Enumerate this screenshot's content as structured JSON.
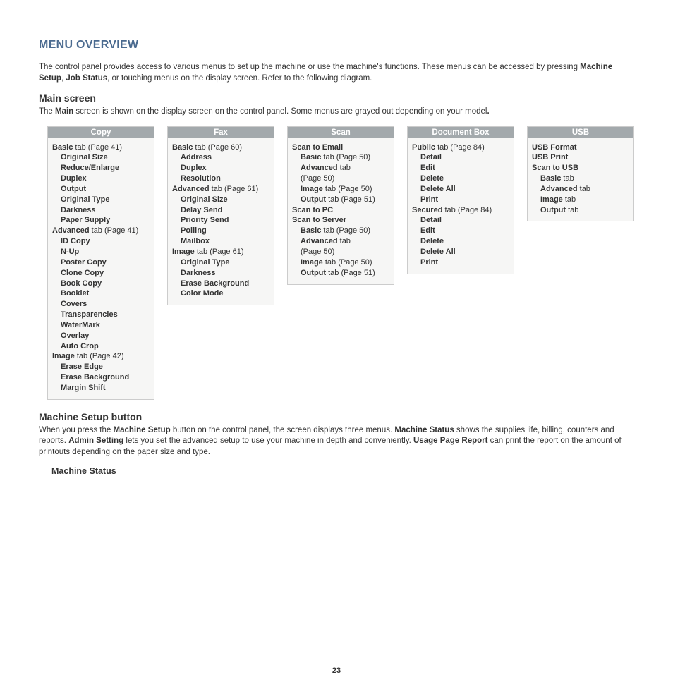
{
  "title": "MENU OVERVIEW",
  "intro_pre": "The control panel provides access to various menus to set up the machine or use the machine's functions. These menus can be accessed by pressing ",
  "intro_b1": "Machine Setup",
  "intro_mid1": ", ",
  "intro_b2": "Job Status",
  "intro_post": ", or touching menus on the display screen. Refer to the following diagram.",
  "main_screen_heading": "Main screen",
  "main_desc_pre": "The ",
  "main_desc_b": "Main",
  "main_desc_post": " screen is shown on the display screen on the control panel. Some menus are grayed out depending on your model",
  "main_desc_dot": ".",
  "columns": {
    "copy": {
      "header": "Copy",
      "items": [
        {
          "lvl": 0,
          "b": "Basic",
          "rest": " tab (Page 41)"
        },
        {
          "lvl": 1,
          "b": "Original Size",
          "rest": ""
        },
        {
          "lvl": 1,
          "b": "Reduce/Enlarge",
          "rest": ""
        },
        {
          "lvl": 1,
          "b": "Duplex",
          "rest": ""
        },
        {
          "lvl": 1,
          "b": "Output",
          "rest": ""
        },
        {
          "lvl": 1,
          "b": "Original Type",
          "rest": ""
        },
        {
          "lvl": 1,
          "b": "Darkness",
          "rest": ""
        },
        {
          "lvl": 1,
          "b": "Paper Supply",
          "rest": ""
        },
        {
          "lvl": 0,
          "b": "Advanced",
          "rest": " tab (Page 41)"
        },
        {
          "lvl": 1,
          "b": "ID Copy",
          "rest": ""
        },
        {
          "lvl": 1,
          "b": "N-Up",
          "rest": ""
        },
        {
          "lvl": 1,
          "b": "Poster Copy",
          "rest": ""
        },
        {
          "lvl": 1,
          "b": "Clone Copy",
          "rest": ""
        },
        {
          "lvl": 1,
          "b": "Book Copy",
          "rest": ""
        },
        {
          "lvl": 1,
          "b": "Booklet",
          "rest": ""
        },
        {
          "lvl": 1,
          "b": "Covers",
          "rest": ""
        },
        {
          "lvl": 1,
          "b": "Transparencies",
          "rest": ""
        },
        {
          "lvl": 1,
          "b": "WaterMark",
          "rest": ""
        },
        {
          "lvl": 1,
          "b": "Overlay",
          "rest": ""
        },
        {
          "lvl": 1,
          "b": "Auto Crop",
          "rest": ""
        },
        {
          "lvl": 0,
          "b": "Image",
          "rest": " tab (Page 42)"
        },
        {
          "lvl": 1,
          "b": "Erase Edge",
          "rest": ""
        },
        {
          "lvl": 1,
          "b": "Erase Background",
          "rest": ""
        },
        {
          "lvl": 1,
          "b": "Margin Shift",
          "rest": ""
        }
      ]
    },
    "fax": {
      "header": "Fax",
      "items": [
        {
          "lvl": 0,
          "b": "Basic",
          "rest": " tab (Page 60)"
        },
        {
          "lvl": 1,
          "b": "Address",
          "rest": ""
        },
        {
          "lvl": 1,
          "b": "Duplex",
          "rest": ""
        },
        {
          "lvl": 1,
          "b": "Resolution",
          "rest": ""
        },
        {
          "lvl": 0,
          "b": "Advanced",
          "rest": " tab (Page 61)"
        },
        {
          "lvl": 1,
          "b": "Original Size",
          "rest": ""
        },
        {
          "lvl": 1,
          "b": "Delay Send",
          "rest": ""
        },
        {
          "lvl": 1,
          "b": "Priority Send",
          "rest": ""
        },
        {
          "lvl": 1,
          "b": "Polling",
          "rest": ""
        },
        {
          "lvl": 1,
          "b": "Mailbox",
          "rest": ""
        },
        {
          "lvl": 0,
          "b": "Image",
          "rest": " tab (Page 61)"
        },
        {
          "lvl": 1,
          "b": "Original Type",
          "rest": ""
        },
        {
          "lvl": 1,
          "b": "Darkness",
          "rest": ""
        },
        {
          "lvl": 1,
          "b": "Erase Background",
          "rest": ""
        },
        {
          "lvl": 1,
          "b": "Color Mode",
          "rest": ""
        }
      ]
    },
    "scan": {
      "header": "Scan",
      "items": [
        {
          "lvl": 0,
          "b": "Scan to Email",
          "rest": ""
        },
        {
          "lvl": 1,
          "b": "Basic",
          "rest": " tab (Page 50)"
        },
        {
          "lvl": 1,
          "b": "Advanced",
          "rest": " tab"
        },
        {
          "lvl": 1,
          "b": "",
          "rest": "(Page 50)"
        },
        {
          "lvl": 1,
          "b": "Image",
          "rest": " tab (Page 50)"
        },
        {
          "lvl": 1,
          "b": "Output",
          "rest": " tab (Page 51)"
        },
        {
          "lvl": 0,
          "b": "Scan to PC",
          "rest": ""
        },
        {
          "lvl": 0,
          "b": "Scan to Server",
          "rest": ""
        },
        {
          "lvl": 1,
          "b": "Basic",
          "rest": " tab (Page 50)"
        },
        {
          "lvl": 1,
          "b": "Advanced",
          "rest": " tab"
        },
        {
          "lvl": 1,
          "b": "",
          "rest": "(Page 50)"
        },
        {
          "lvl": 1,
          "b": "Image",
          "rest": " tab (Page 50)"
        },
        {
          "lvl": 1,
          "b": "Output",
          "rest": " tab (Page 51)"
        }
      ]
    },
    "docbox": {
      "header": "Document Box",
      "items": [
        {
          "lvl": 0,
          "b": "Public",
          "rest": " tab (Page 84)"
        },
        {
          "lvl": 1,
          "b": "Detail",
          "rest": ""
        },
        {
          "lvl": 1,
          "b": "Edit",
          "rest": ""
        },
        {
          "lvl": 1,
          "b": "Delete",
          "rest": ""
        },
        {
          "lvl": 1,
          "b": "Delete All",
          "rest": ""
        },
        {
          "lvl": 1,
          "b": "Print",
          "rest": ""
        },
        {
          "lvl": 0,
          "b": "Secured",
          "rest": " tab (Page 84)"
        },
        {
          "lvl": 1,
          "b": "Detail",
          "rest": ""
        },
        {
          "lvl": 1,
          "b": "Edit",
          "rest": ""
        },
        {
          "lvl": 1,
          "b": "Delete",
          "rest": ""
        },
        {
          "lvl": 1,
          "b": "Delete All",
          "rest": ""
        },
        {
          "lvl": 1,
          "b": "Print",
          "rest": ""
        }
      ]
    },
    "usb": {
      "header": "USB",
      "items": [
        {
          "lvl": 0,
          "b": "USB Format",
          "rest": ""
        },
        {
          "lvl": 0,
          "b": "USB Print",
          "rest": ""
        },
        {
          "lvl": 0,
          "b": "Scan to USB",
          "rest": ""
        },
        {
          "lvl": 1,
          "b": "Basic",
          "rest": " tab"
        },
        {
          "lvl": 1,
          "b": "Advanced",
          "rest": " tab"
        },
        {
          "lvl": 1,
          "b": "Image",
          "rest": " tab"
        },
        {
          "lvl": 1,
          "b": "Output",
          "rest": " tab"
        }
      ]
    }
  },
  "machine_setup_heading": "Machine Setup button",
  "ms_pre": "When you press the ",
  "ms_b1": "Machine Setup",
  "ms_mid1": " button on the control panel, the screen displays three menus. ",
  "ms_b2": "Machine Status",
  "ms_mid2": " shows the supplies life, billing, counters and reports. ",
  "ms_b3": "Admin Setting",
  "ms_mid3": " lets you set the advanced setup to use your machine in depth and conveniently. ",
  "ms_b4": "Usage Page Report",
  "ms_post": " can print the report on the amount of printouts depending on the paper size and type.",
  "machine_status_heading": "Machine Status",
  "page_number": "23"
}
